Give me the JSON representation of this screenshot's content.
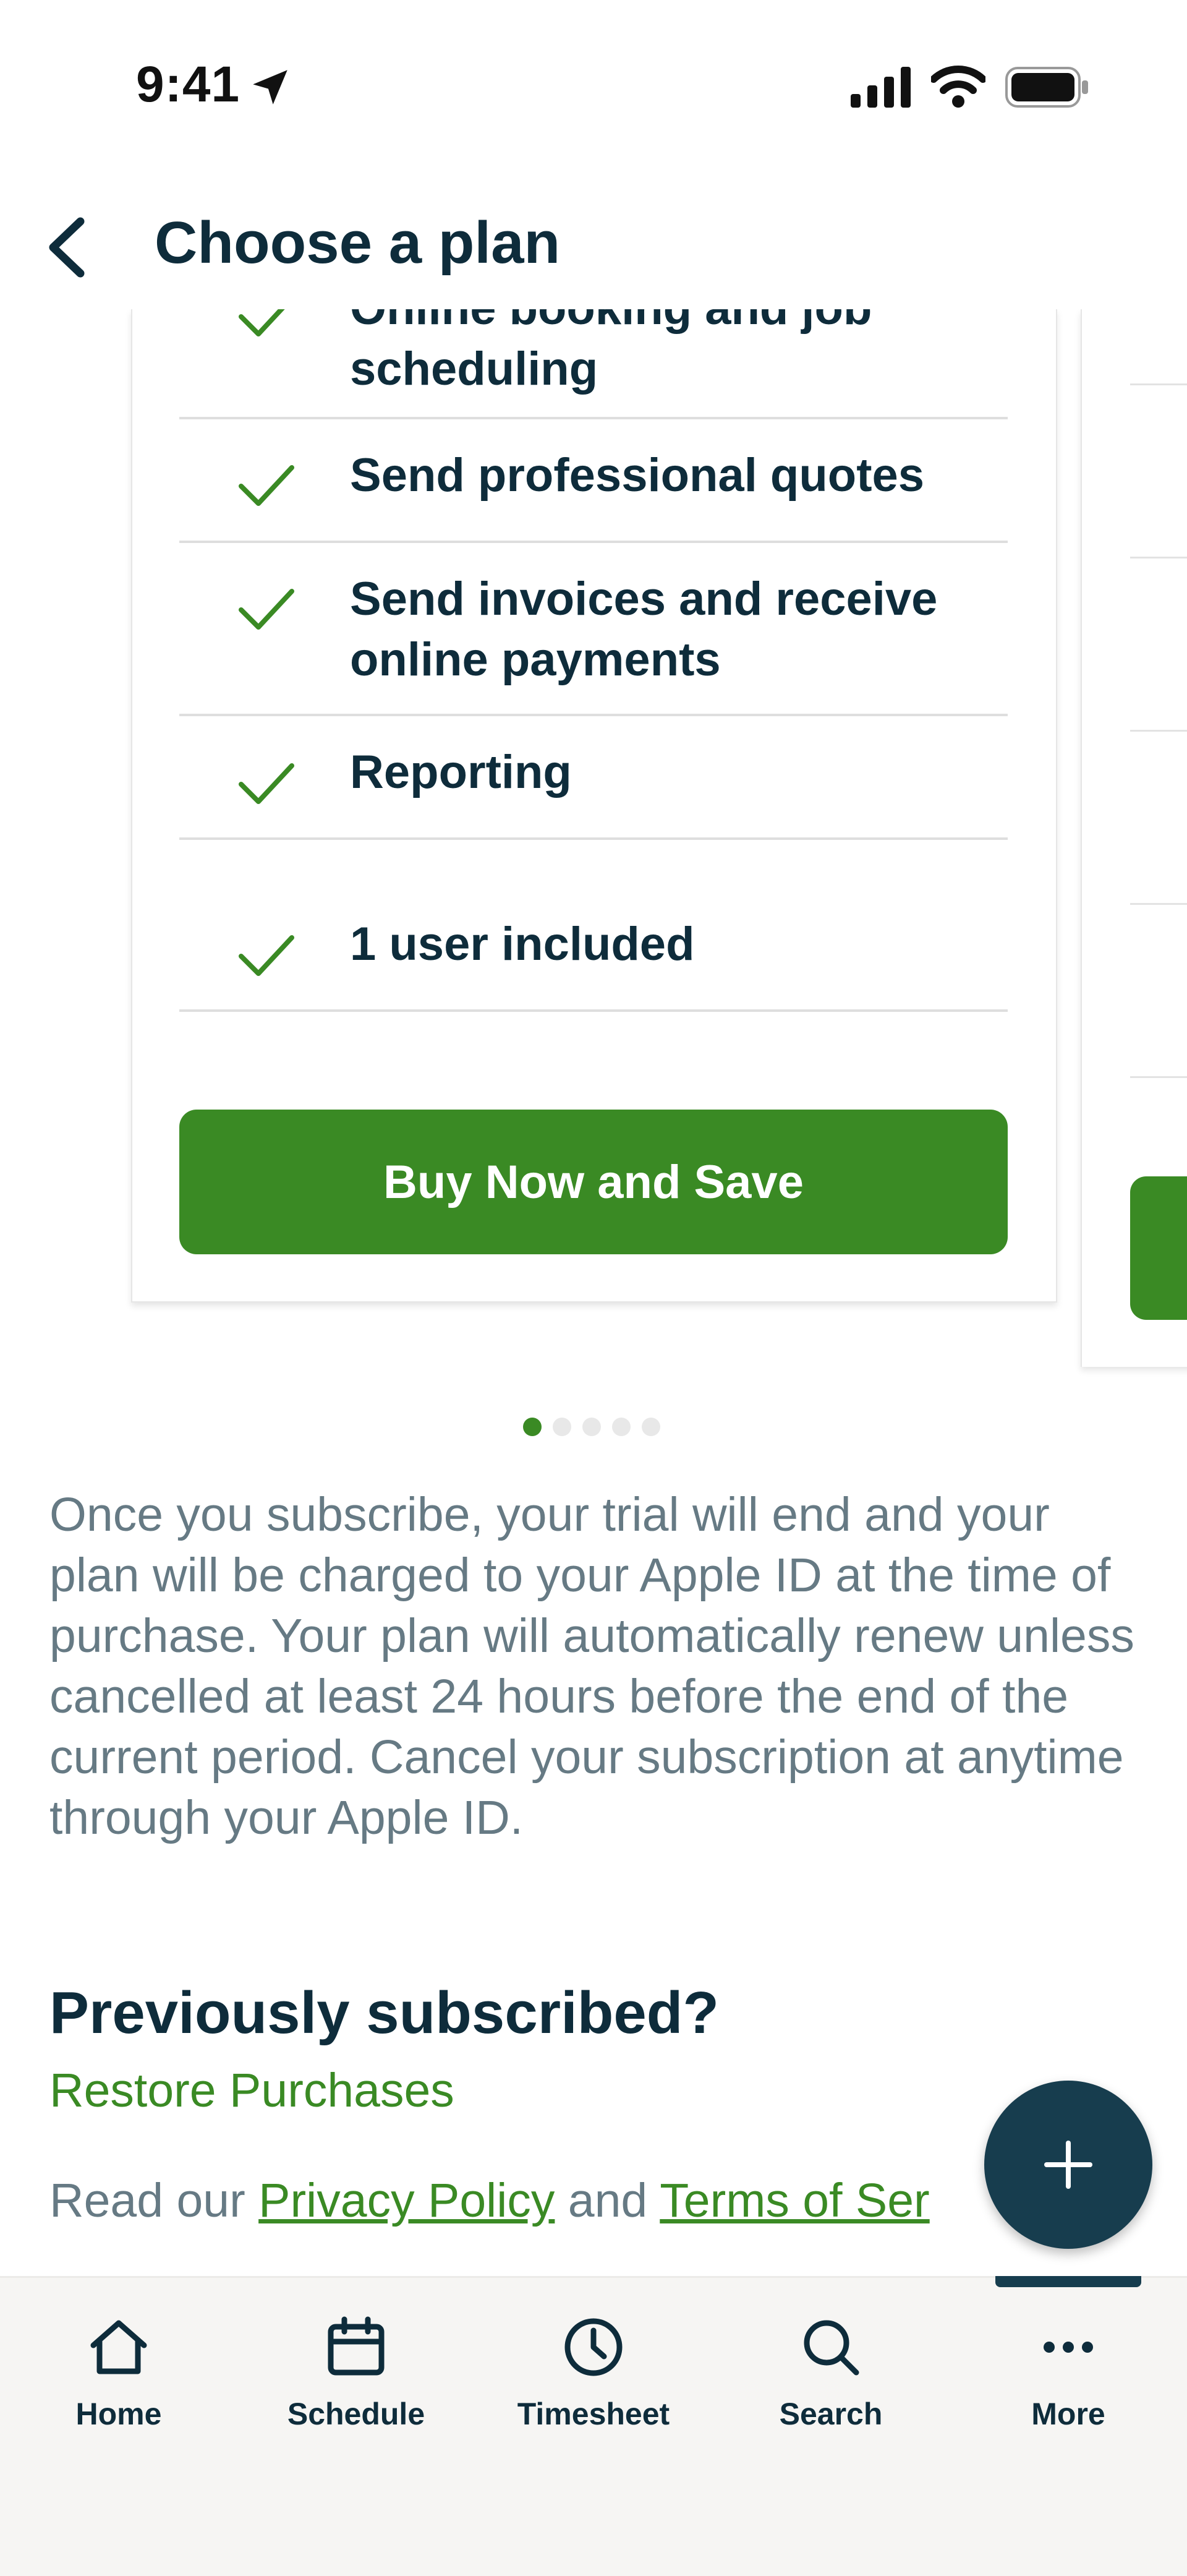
{
  "status_bar": {
    "time": "9:41"
  },
  "header": {
    "title": "Choose a plan"
  },
  "plan_card": {
    "features": [
      "Online booking and job scheduling",
      "Send professional quotes",
      "Send invoices and receive online payments",
      "Reporting",
      "1 user included"
    ],
    "buy_label": "Buy Now and Save"
  },
  "carousel": {
    "pages": 5,
    "active_index": 0
  },
  "disclaimer": "Once you subscribe, your trial will end and your plan will be charged to your Apple ID at the time of purchase. Your plan will automatically renew unless cancelled at least 24 hours before the end of the current period. Cancel your subscription at anytime through your Apple ID.",
  "previously": {
    "heading": "Previously subscribed?",
    "restore_label": "Restore Purchases"
  },
  "legal": {
    "prefix": "Read our ",
    "privacy_label": "Privacy Policy",
    "and_text": " and ",
    "terms_label": "Terms of Ser"
  },
  "tabbar": {
    "items": [
      {
        "label": "Home",
        "icon": "home-icon"
      },
      {
        "label": "Schedule",
        "icon": "calendar-icon"
      },
      {
        "label": "Timesheet",
        "icon": "clock-icon"
      },
      {
        "label": "Search",
        "icon": "search-icon"
      },
      {
        "label": "More",
        "icon": "more-icon"
      }
    ],
    "active": "More"
  },
  "colors": {
    "brand_green": "#3a8a24",
    "navy": "#0e2c3b",
    "fab": "#173d4e",
    "muted_text": "#667a84"
  }
}
